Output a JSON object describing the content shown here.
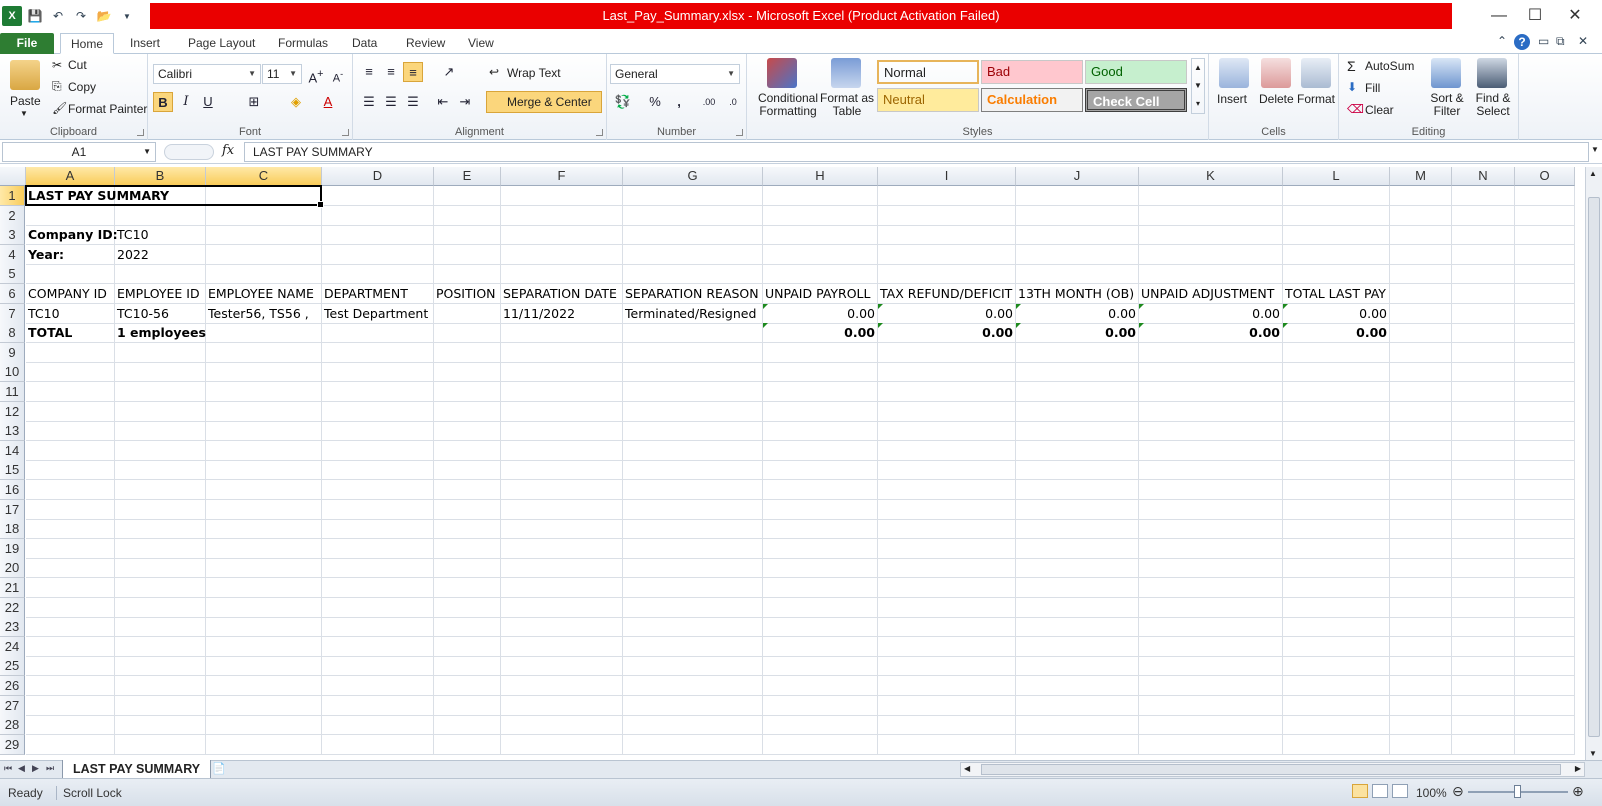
{
  "window": {
    "title": "Last_Pay_Summary.xlsx  -  Microsoft Excel (Product Activation Failed)",
    "minimize_glyph": "—",
    "maximize_glyph": "☐",
    "close_glyph": "✕"
  },
  "tabs": [
    "File",
    "Home",
    "Insert",
    "Page Layout",
    "Formulas",
    "Data",
    "Review",
    "View"
  ],
  "ribbon": {
    "clipboard": {
      "label": "Clipboard",
      "paste": "Paste",
      "cut": "Cut",
      "copy": "Copy",
      "format_painter": "Format Painter"
    },
    "font": {
      "label": "Font",
      "name": "Calibri",
      "size": "11"
    },
    "alignment": {
      "label": "Alignment",
      "wrap_text": "Wrap Text",
      "merge_center": "Merge & Center"
    },
    "number": {
      "label": "Number",
      "format": "General"
    },
    "styles": {
      "label": "Styles",
      "conditional_formatting": "Conditional Formatting",
      "format_as_table": "Format as Table",
      "cells": [
        {
          "name": "Normal",
          "bg": "#ffffff",
          "fg": "#000000"
        },
        {
          "name": "Bad",
          "bg": "#ffc7ce",
          "fg": "#9c0006"
        },
        {
          "name": "Good",
          "bg": "#c6efce",
          "fg": "#006100"
        },
        {
          "name": "Neutral",
          "bg": "#ffeb9c",
          "fg": "#9c6500"
        },
        {
          "name": "Calculation",
          "bg": "#f2f2f2",
          "fg": "#fa7d00"
        },
        {
          "name": "Check Cell",
          "bg": "#a5a5a5",
          "fg": "#ffffff"
        }
      ]
    },
    "cells": {
      "label": "Cells",
      "insert": "Insert",
      "delete": "Delete",
      "format": "Format"
    },
    "editing": {
      "label": "Editing",
      "autosum": "AutoSum",
      "fill": "Fill",
      "clear": "Clear",
      "sort_filter": "Sort & Filter",
      "find_select": "Find & Select"
    }
  },
  "formula_bar": {
    "name_box": "A1",
    "fx": "fx",
    "formula": "LAST PAY SUMMARY"
  },
  "columns": [
    "A",
    "B",
    "C",
    "D",
    "E",
    "F",
    "G",
    "H",
    "I",
    "J",
    "K",
    "L",
    "M",
    "N",
    "O"
  ],
  "rows": [
    "1",
    "2",
    "3",
    "4",
    "5",
    "6",
    "7",
    "8",
    "9",
    "10",
    "11",
    "12",
    "13",
    "14",
    "15",
    "16",
    "17",
    "18",
    "19",
    "20",
    "21",
    "22",
    "23",
    "24",
    "25",
    "26",
    "27",
    "28",
    "29"
  ],
  "sheet": {
    "title": "LAST PAY SUMMARY",
    "company_id_label": "Company ID:",
    "company_id": "TC10",
    "year_label": "Year:",
    "year": "2022",
    "headers": [
      "COMPANY ID",
      "EMPLOYEE ID",
      "EMPLOYEE NAME",
      "DEPARTMENT",
      "POSITION",
      "SEPARATION DATE",
      "SEPARATION REASON",
      "UNPAID PAYROLL",
      "TAX REFUND/DEFICIT",
      "13TH MONTH (OB)",
      "UNPAID ADJUSTMENT",
      "TOTAL LAST PAY"
    ],
    "data_row": [
      "TC10",
      "TC10-56",
      "Tester56, TS56 ,",
      "Test Department",
      "",
      "11/11/2022",
      "Terminated/Resigned",
      "0.00",
      "0.00",
      "0.00",
      "0.00",
      "0.00"
    ],
    "total_row": [
      "TOTAL",
      "1 employees",
      "",
      "",
      "",
      "",
      "",
      "0.00",
      "0.00",
      "0.00",
      "0.00",
      "0.00"
    ]
  },
  "sheet_tab": "LAST PAY SUMMARY",
  "status": {
    "ready": "Ready",
    "scroll_lock": "Scroll Lock",
    "zoom": "100%"
  }
}
